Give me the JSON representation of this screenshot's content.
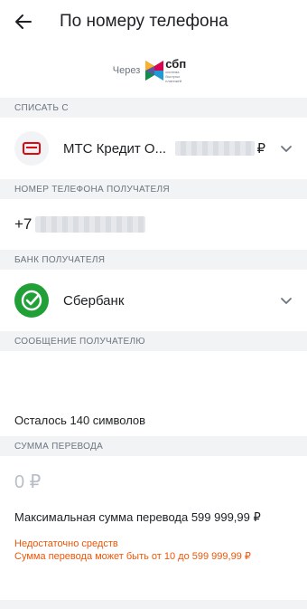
{
  "header": {
    "title": "По номеру телефона",
    "back_icon": "arrow-left-icon"
  },
  "sbp": {
    "via_label": "Через",
    "logo_text": "сбп",
    "logo_subtext": "система быстрых платежей"
  },
  "sections": {
    "debit_from": "СПИСАТЬ С",
    "recipient_phone": "НОМЕР ТЕЛЕФОНА ПОЛУЧАТЕЛЯ",
    "recipient_bank": "БАНК ПОЛУЧАТЕЛЯ",
    "recipient_message": "СООБЩЕНИЕ ПОЛУЧАТЕЛЮ",
    "transfer_amount": "СУММА ПЕРЕВОДА"
  },
  "account": {
    "name": "МТС Кредит О...",
    "currency": "₽",
    "icon": "credit-card-icon"
  },
  "phone": {
    "prefix": "+7"
  },
  "bank": {
    "name": "Сбербанк",
    "icon": "sberbank-logo-icon"
  },
  "message": {
    "remaining": "Осталось 140 символов"
  },
  "amount": {
    "value": "0 ₽",
    "max_text": "Максимальная сумма перевода 599 999,99 ₽",
    "error_insufficient": "Недостаточно средств",
    "error_range": "Сумма перевода может быть от 10 до 599 999,99 ₽"
  },
  "colors": {
    "accent_red": "#e30611",
    "sber_green": "#21a038",
    "error_orange": "#e8570b",
    "section_bg": "#f2f3f5"
  }
}
